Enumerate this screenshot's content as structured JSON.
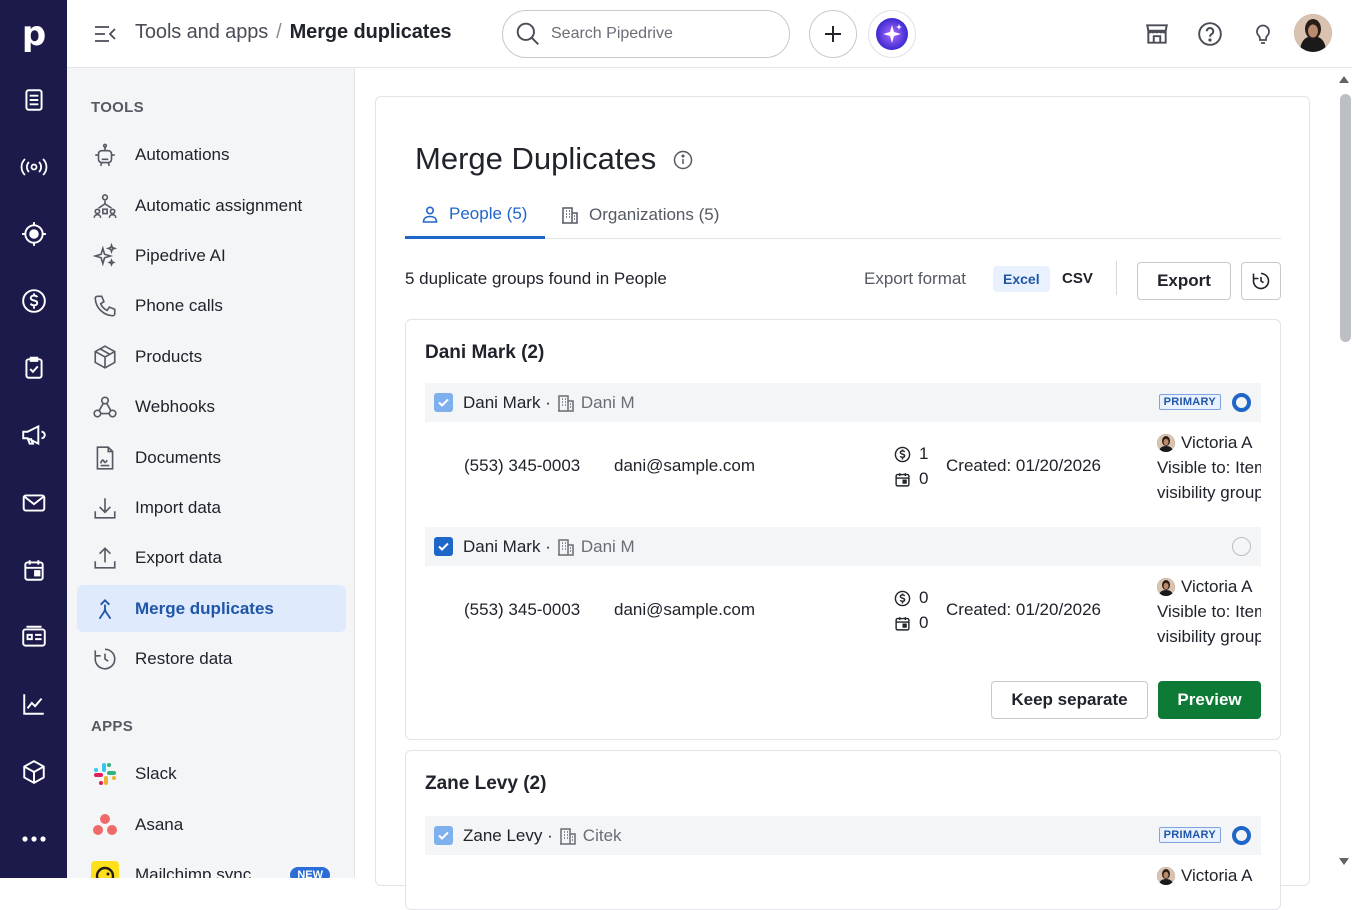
{
  "app": {
    "logo_letter": "p",
    "brand_color": "#1c1a4a",
    "rail_icons": [
      "leads-icon",
      "broadcast-icon",
      "target-icon",
      "dollar-icon",
      "tasks-icon",
      "megaphone-icon",
      "mail-icon",
      "calendar-icon",
      "contacts-icon",
      "insights-icon",
      "products-icon",
      "more-icon"
    ]
  },
  "header": {
    "breadcrumb_parent": "Tools and apps",
    "breadcrumb_separator": "/",
    "breadcrumb_current": "Merge duplicates",
    "search_placeholder": "Search Pipedrive"
  },
  "sidebar": {
    "tools_title": "TOOLS",
    "tools": [
      {
        "label": "Automations",
        "icon": "robot-icon"
      },
      {
        "label": "Automatic assignment",
        "icon": "assignment-icon"
      },
      {
        "label": "Pipedrive AI",
        "icon": "sparkle-icon"
      },
      {
        "label": "Phone calls",
        "icon": "phone-icon"
      },
      {
        "label": "Products",
        "icon": "box-icon"
      },
      {
        "label": "Webhooks",
        "icon": "webhook-icon"
      },
      {
        "label": "Documents",
        "icon": "document-icon"
      },
      {
        "label": "Import data",
        "icon": "import-icon"
      },
      {
        "label": "Export data",
        "icon": "export-icon"
      },
      {
        "label": "Merge duplicates",
        "icon": "merge-icon",
        "active": true
      },
      {
        "label": "Restore data",
        "icon": "restore-icon"
      }
    ],
    "apps_title": "APPS",
    "apps": [
      {
        "label": "Slack",
        "icon": "slack-icon"
      },
      {
        "label": "Asana",
        "icon": "asana-icon"
      },
      {
        "label": "Mailchimp sync",
        "icon": "mailchimp-icon",
        "badge": "NEW"
      }
    ]
  },
  "page": {
    "title": "Merge Duplicates",
    "tabs": [
      {
        "label": "People (5)",
        "active": true
      },
      {
        "label": "Organizations (5)",
        "active": false
      }
    ],
    "summary": "5 duplicate groups found in People",
    "export_format_label": "Export format",
    "format_excel": "Excel",
    "format_csv": "CSV",
    "export_button": "Export",
    "groups": [
      {
        "name": "Dani Mark (2)",
        "records": [
          {
            "name": "Dani Mark",
            "sep": "·",
            "org": "Dani M",
            "primary": "PRIMARY",
            "phone": "(553) 345-0003",
            "email": "dani@sample.com",
            "deals": "1",
            "activities": "0",
            "created": "Created: 01/20/2026",
            "owner": "Victoria A",
            "visible_1": "Visible to: Item o",
            "visible_2": "visibility group"
          },
          {
            "name": "Dani Mark",
            "sep": "·",
            "org": "Dani M",
            "phone": "(553) 345-0003",
            "email": "dani@sample.com",
            "deals": "0",
            "activities": "0",
            "created": "Created: 01/20/2026",
            "owner": "Victoria A",
            "visible_1": "Visible to: Item o",
            "visible_2": "visibility group"
          }
        ],
        "keep_separate": "Keep separate",
        "preview": "Preview"
      },
      {
        "name": "Zane Levy (2)",
        "records": [
          {
            "name": "Zane Levy",
            "sep": "·",
            "org": "Citek",
            "primary": "PRIMARY",
            "owner": "Victoria A"
          }
        ]
      }
    ]
  },
  "colors": {
    "accent": "#1f66c9",
    "primary_green": "#0d7a36",
    "active_bg": "#dfeafd"
  }
}
